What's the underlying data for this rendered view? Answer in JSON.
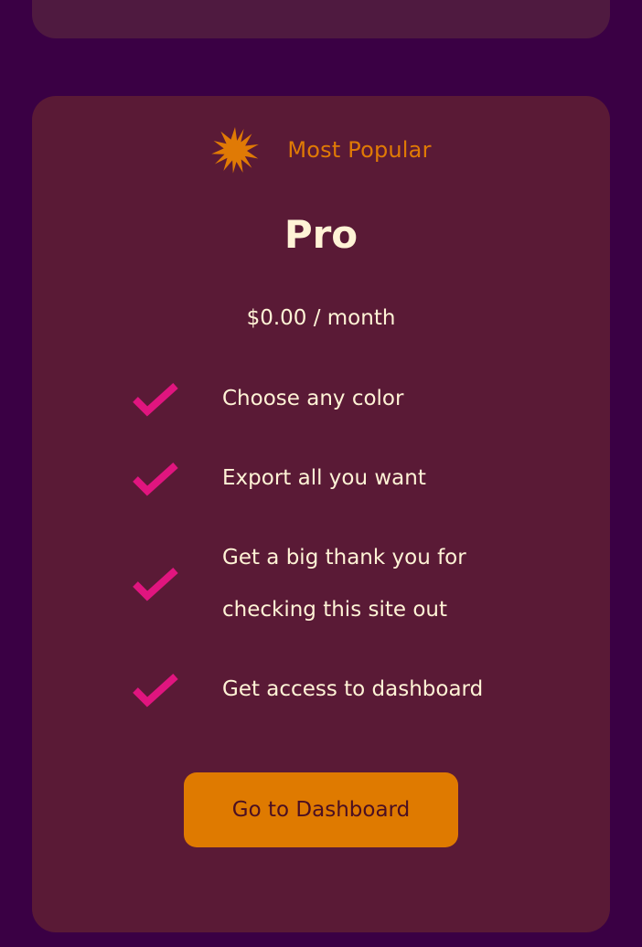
{
  "badge": {
    "icon": "starburst-icon",
    "label": "Most Popular",
    "color": "#e07a05"
  },
  "plan": {
    "name": "Pro",
    "price": "$0.00 / month"
  },
  "features": [
    {
      "icon": "checkmark-icon",
      "text": "Choose any color"
    },
    {
      "icon": "checkmark-icon",
      "text": "Export all you want"
    },
    {
      "icon": "checkmark-icon",
      "text": "Get a big thank you for checking this site out"
    },
    {
      "icon": "checkmark-icon",
      "text": "Get access to dashboard"
    }
  ],
  "cta": {
    "label": "Go to Dashboard"
  },
  "colors": {
    "background": "#3a0044",
    "card": "#5a1a36",
    "previous_card": "#4f1a40",
    "text": "#fff3d6",
    "check": "#e0157f",
    "button": "#df7a00"
  }
}
